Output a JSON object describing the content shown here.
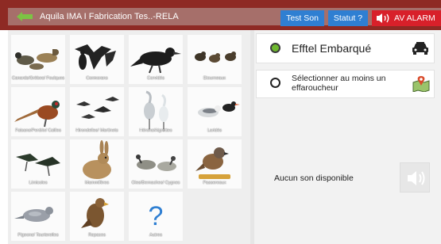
{
  "header": {
    "title": "Aquila IMA  I  Fabrication Tes..-RELA",
    "test_son": "Test Son",
    "statut": "Statut ?",
    "alarm": "AV ALARM"
  },
  "colors": {
    "topbar": "#8e2a24",
    "accent_blue": "#2f7fd2",
    "alarm_red": "#d8202a",
    "active_green": "#6eb82f"
  },
  "categories": [
    {
      "label": "Canards/Grèbes/ Foulques",
      "icon": "ducks-icon"
    },
    {
      "label": "Cormorans",
      "icon": "cormorant-icon"
    },
    {
      "label": "Corvidés",
      "icon": "crow-icon"
    },
    {
      "label": "Etourneaux",
      "icon": "starlings-icon"
    },
    {
      "label": "Faisans/Perdrix/ Cailles",
      "icon": "pheasant-icon"
    },
    {
      "label": "Hirondelles/ Martinets",
      "icon": "swallows-icon"
    },
    {
      "label": "Hérons/Aigrettes",
      "icon": "herons-icon"
    },
    {
      "label": "Laridés",
      "icon": "gulls-icon"
    },
    {
      "label": "Limicoles",
      "icon": "waders-icon"
    },
    {
      "label": "Mammifères",
      "icon": "hare-icon"
    },
    {
      "label": "Oies/Bernaches/ Cygnes",
      "icon": "geese-icon"
    },
    {
      "label": "Passereaux",
      "icon": "sparrow-icon"
    },
    {
      "label": "Pigeons/ Tourterelles",
      "icon": "pigeon-icon"
    },
    {
      "label": "Rapaces",
      "icon": "raptor-icon"
    },
    {
      "label": "Autres",
      "icon": "question-icon"
    }
  ],
  "panel": {
    "effel": "Efftel Embarqué",
    "select": "Sélectionner au moins un effaroucheur",
    "no_sound": "Aucun son disponible"
  }
}
